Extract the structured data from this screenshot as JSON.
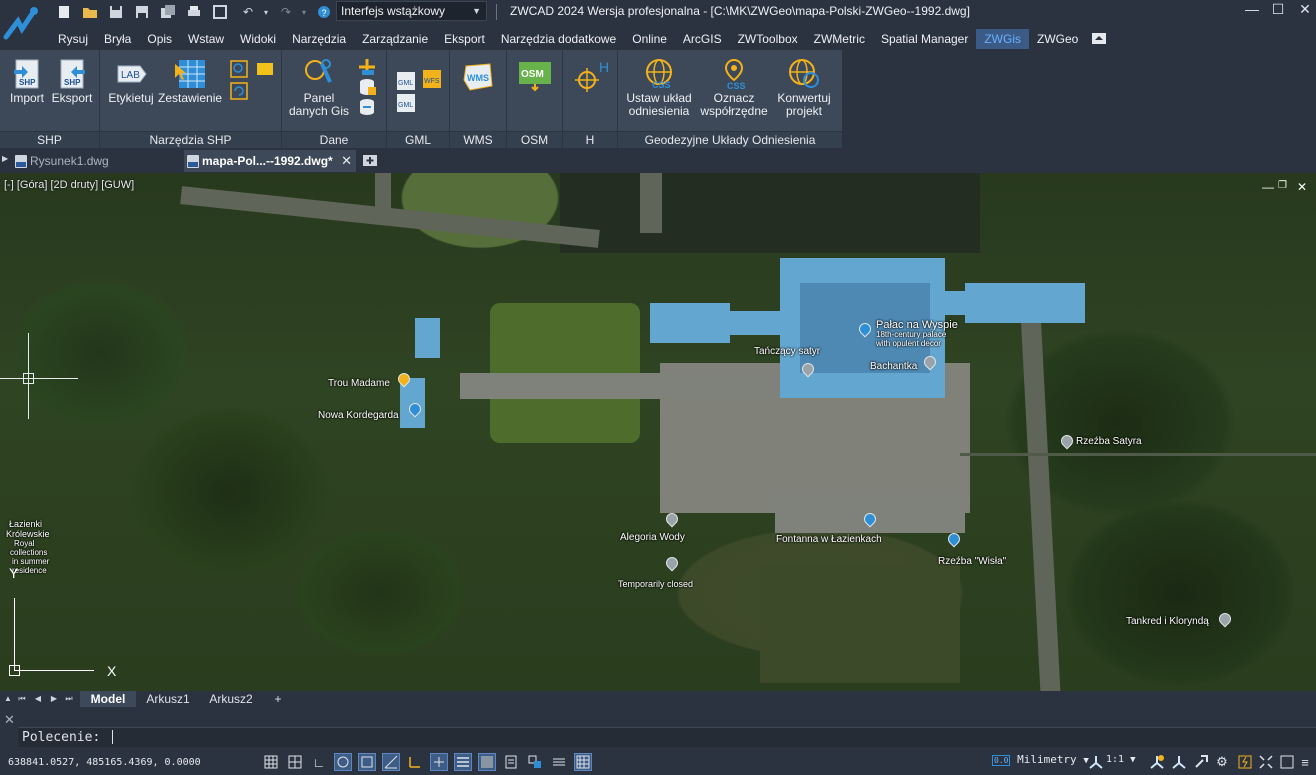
{
  "titlebar": {
    "workspace": "Interfejs wstążkowy",
    "title": "ZWCAD 2024 Wersja profesjonalna - [C:\\MK\\ZWGeo\\mapa-Polski-ZWGeo--1992.dwg]"
  },
  "menubar": {
    "items": [
      "Rysuj",
      "Bryła",
      "Opis",
      "Wstaw",
      "Widoki",
      "Narzędzia",
      "Zarządzanie",
      "Eksport",
      "Narzędzia dodatkowe",
      "Online",
      "ArcGIS",
      "ZWToolbox",
      "ZWMetric",
      "Spatial Manager",
      "ZWGis",
      "ZWGeo"
    ],
    "active": "ZWGis"
  },
  "ribbon": {
    "groups": {
      "shp": "SHP",
      "shp_tools": "Narzędzia SHP",
      "dane": "Dane",
      "gml": "GML",
      "wms": "WMS",
      "osm": "OSM",
      "h": "H",
      "geo": "Geodezyjne Układy Odniesienia"
    },
    "buttons": {
      "import": "Import",
      "eksport": "Eksport",
      "etykietuj": "Etykietuj",
      "zestawienie": "Zestawienie",
      "panel_1": "Panel",
      "panel_2": "danych Gis",
      "ustaw_1": "Ustaw układ",
      "ustaw_2": "odniesienia",
      "oznacz_1": "Oznacz",
      "oznacz_2": "współrzędne",
      "konwertuj_1": "Konwertuj",
      "konwertuj_2": "projekt"
    },
    "icon_text": {
      "shp": "SHP",
      "lab": "LAB",
      "gml": "GML",
      "wfs": "WFS",
      "wms": "WMS",
      "osm": "OSM",
      "h": "H",
      "css": "CSS"
    }
  },
  "doctabs": {
    "tab1": "Rysunek1.dwg",
    "tab2": "mapa-Pol...--1992.dwg*"
  },
  "viewport": {
    "label": "[-] [Góra] [2D druty] [GUW]",
    "ucs_x": "X",
    "ucs_y": "Y"
  },
  "map_labels": {
    "trou_madame": "Trou Madame",
    "nowa_kordegarda": "Nowa Kordegarda",
    "tanczacy_satyr": "Tańczący satyr",
    "palac_1": "Pałac na Wyspie",
    "palac_2": "18th-century palace",
    "palac_3": "with opulent decor",
    "bachantka": "Bachantka",
    "rzezba_satyra": "Rzeźba Satyra",
    "alegoria_wody": "Alegoria Wody",
    "temporarily_closed": "Temporarily closed",
    "fontanna": "Fontanna w Łazienkach",
    "rzezba_wisla": "Rzeźba \"Wisła\"",
    "tankred": "Tankred i Kloryndą",
    "lazienki_1": "Łazienki",
    "lazienki_2": "Królewskie",
    "lazienki_3": "Royal",
    "lazienki_4": "collections",
    "lazienki_5": "in summer",
    "lazienki_6": "residence"
  },
  "layout_tabs": {
    "model": "Model",
    "arkusz1": "Arkusz1",
    "arkusz2": "Arkusz2",
    "add": "+"
  },
  "command": {
    "label": "Polecenie:"
  },
  "status": {
    "coords": "638841.0527, 485165.4369, 0.0000",
    "units": "Milimetry",
    "scale": "1:1"
  },
  "colors": {
    "active_menu_text": "#69b0ff",
    "ribbon_bg": "#3d4858",
    "window_bg": "#2b3340"
  }
}
